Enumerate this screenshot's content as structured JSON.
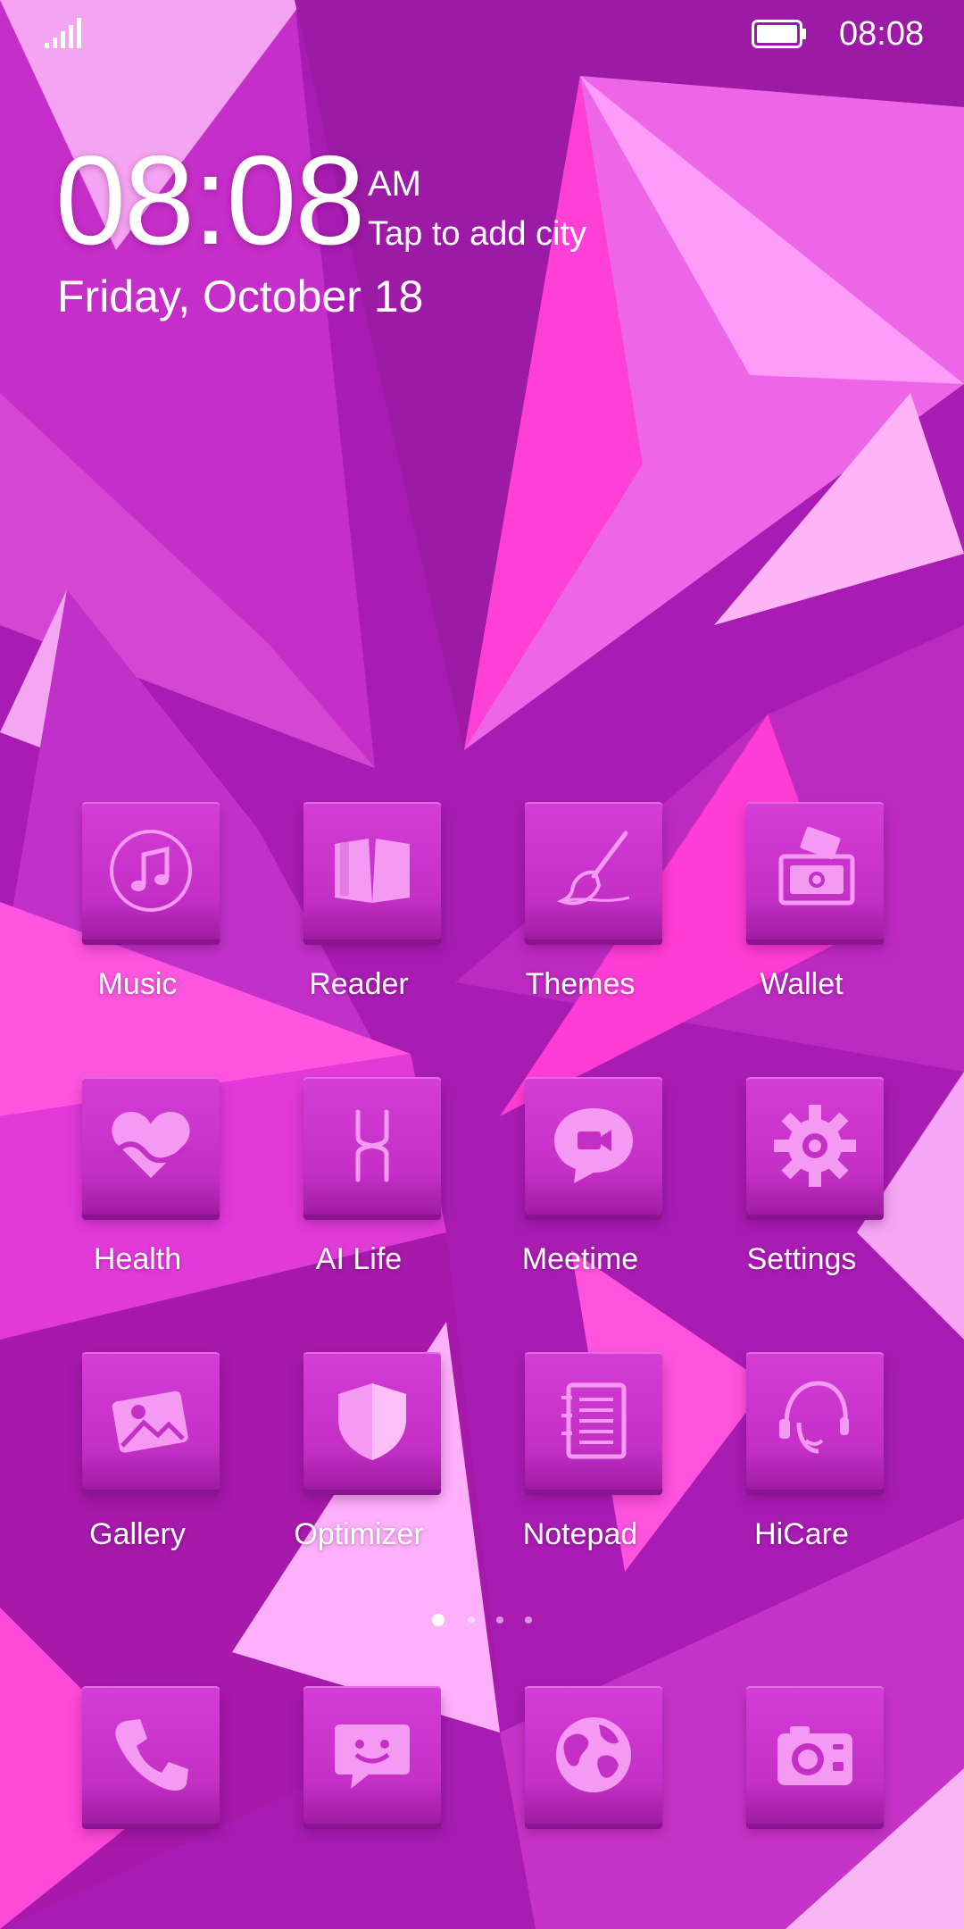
{
  "status_bar": {
    "time": "08:08"
  },
  "clock_widget": {
    "time": "08:08",
    "ampm": "AM",
    "city": "Tap to add city",
    "date": "Friday, October 18"
  },
  "apps": [
    {
      "label": "Music",
      "icon": "music-icon"
    },
    {
      "label": "Reader",
      "icon": "book-icon"
    },
    {
      "label": "Themes",
      "icon": "paintbrush-icon"
    },
    {
      "label": "Wallet",
      "icon": "wallet-icon"
    },
    {
      "label": "Health",
      "icon": "heart-icon"
    },
    {
      "label": "AI Life",
      "icon": "ai-life-icon"
    },
    {
      "label": "Meetime",
      "icon": "video-chat-icon"
    },
    {
      "label": "Settings",
      "icon": "gear-icon"
    },
    {
      "label": "Gallery",
      "icon": "image-icon"
    },
    {
      "label": "Optimizer",
      "icon": "shield-icon"
    },
    {
      "label": "Notepad",
      "icon": "notepad-icon"
    },
    {
      "label": "HiCare",
      "icon": "headset-icon"
    }
  ],
  "page_indicator": {
    "pages": 4,
    "current": 1
  },
  "dock": [
    {
      "icon": "phone-icon"
    },
    {
      "icon": "message-icon"
    },
    {
      "icon": "globe-icon"
    },
    {
      "icon": "camera-icon"
    }
  ],
  "colors": {
    "wallpaper_base": "#b21fb8",
    "tile": "#c42fc6",
    "icon_glyph": "#f59af3"
  }
}
